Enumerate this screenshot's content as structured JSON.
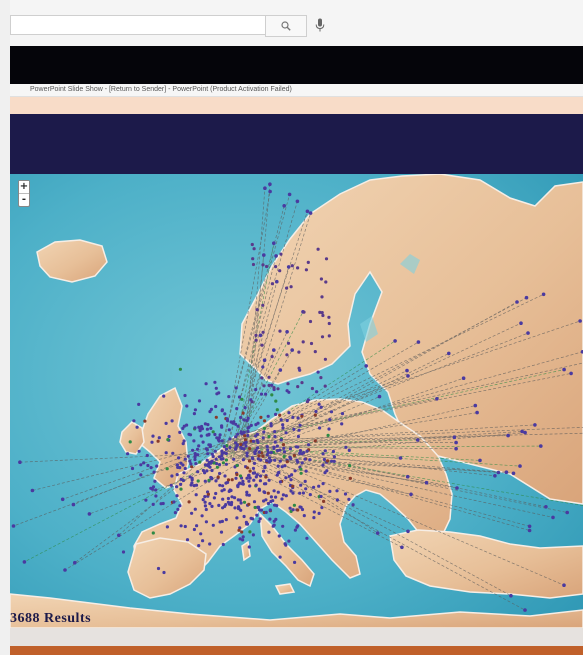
{
  "search": {
    "value": "",
    "placeholder": ""
  },
  "icons": {
    "search": "search-icon",
    "mic": "microphone-icon"
  },
  "window_title": "PowerPoint Slide Show - [Return to Sender] - PowerPoint (Product Activation Failed)",
  "map": {
    "zoom_in_label": "+",
    "zoom_out_label": "-",
    "results_label": "3688 Results"
  },
  "colors": {
    "header_navy": "#1c1a4a",
    "peach": "#f8dcc8",
    "sea": "#55b4cc",
    "land": "#e9c39e",
    "dot": "#4a3aa0",
    "line": "#555555",
    "accent_green": "#2e8a45",
    "footer_orange": "#c0602a"
  }
}
